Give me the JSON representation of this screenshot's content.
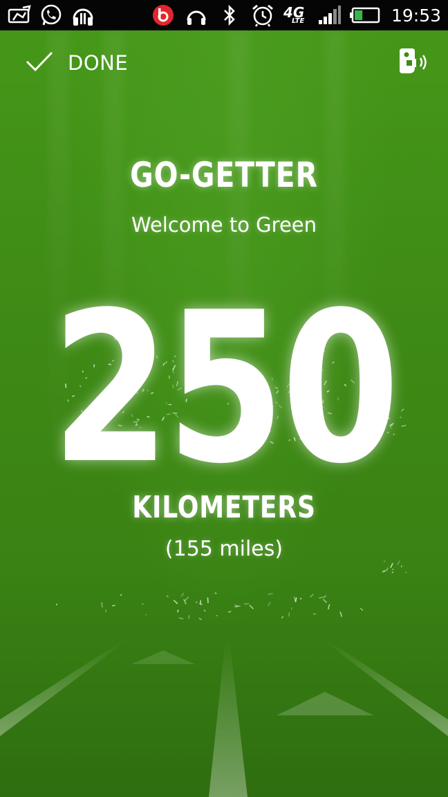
{
  "status_bar": {
    "network_type": "4G",
    "network_subtype": "LTE",
    "battery_level": 0.35,
    "time": "19:53",
    "icons_left": [
      "photo-notification-icon",
      "whatsapp-icon",
      "play-music-icon"
    ],
    "icons_right": [
      "beats-audio-icon",
      "headphones-icon",
      "bluetooth-icon",
      "alarm-clock-icon",
      "signal-strength-icon",
      "battery-icon"
    ]
  },
  "top_bar": {
    "done_label": "DONE",
    "done_icon": "checkmark-icon",
    "audio_icon": "voice-feedback-icon"
  },
  "achievement": {
    "title": "GO-GETTER",
    "subtitle": "Welcome to Green",
    "value": "250",
    "unit": "KILOMETERS",
    "conversion": "(155 miles)"
  },
  "colors": {
    "background": "#3f8b16",
    "status_bar": "#050505",
    "text": "#ffffff",
    "beats_red": "#e3262b"
  }
}
